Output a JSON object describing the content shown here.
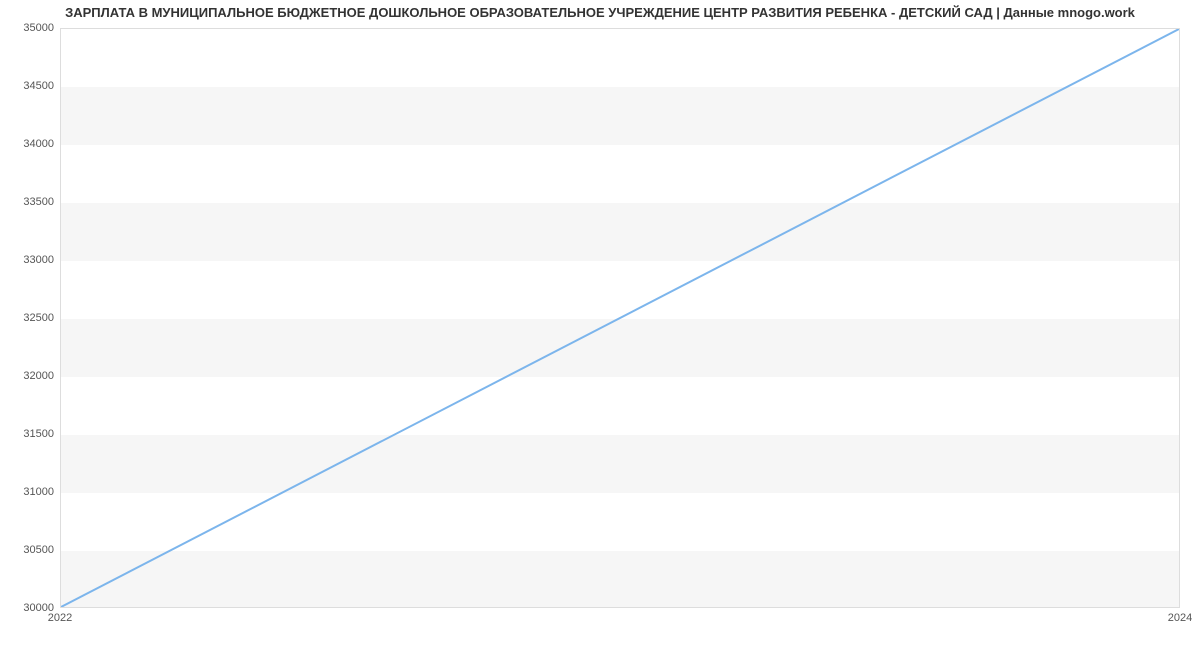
{
  "chart_data": {
    "type": "line",
    "title": "ЗАРПЛАТА В МУНИЦИПАЛЬНОЕ БЮДЖЕТНОЕ ДОШКОЛЬНОЕ ОБРАЗОВАТЕЛЬНОЕ УЧРЕЖДЕНИЕ ЦЕНТР РАЗВИТИЯ РЕБЕНКА - ДЕТСКИЙ САД | Данные mnogo.work",
    "x": [
      2022,
      2024
    ],
    "values": [
      30000,
      35000
    ],
    "xlabel": "",
    "ylabel": "",
    "xticks": [
      "2022",
      "2024"
    ],
    "yticks": [
      "30000",
      "30500",
      "31000",
      "31500",
      "32000",
      "32500",
      "33000",
      "33500",
      "34000",
      "34500",
      "35000"
    ],
    "ylim": [
      30000,
      35000
    ],
    "xlim": [
      2022,
      2024
    ],
    "line_color": "#7cb5ec"
  }
}
